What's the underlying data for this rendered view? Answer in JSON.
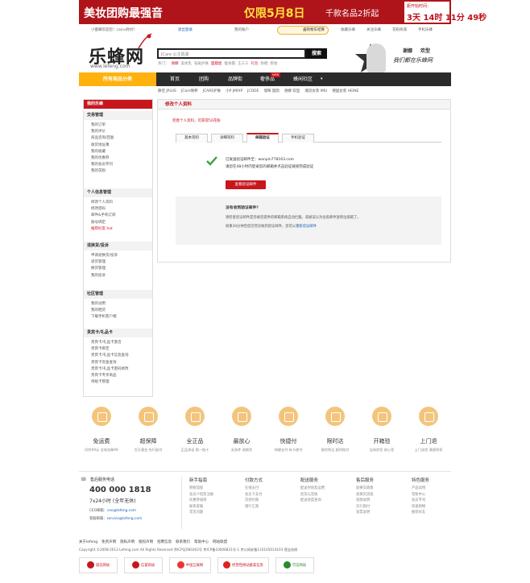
{
  "banner": {
    "headline": "美妆团购最强音",
    "promo": "仅限5月8日",
    "sub": "千款名品2折起",
    "countdown_label": "距开始时间：",
    "countdown": "3天 14时 11分 49秒"
  },
  "topbar": {
    "greeting": "小蜜蜂欢迎您！cairui你好！",
    "logout": "退出登录",
    "account": "我的账户",
    "cart": "去购物车结算",
    "bookmark": "收藏乐蜂",
    "follow": "关注乐蜂",
    "mall": "花粉商城",
    "mobile": "手机乐蜂"
  },
  "logo": {
    "name": "乐蜂网",
    "url": "www.lefeng.com"
  },
  "search": {
    "placeholder": "JCare 公主肌妻",
    "button": "搜索",
    "hot_label": "热门：",
    "hot": [
      "谢娜",
      "美体乳",
      "祛斑护肤",
      "面膜屋",
      "瘦身霜",
      "王三三",
      "礼包",
      "防晒",
      "卸妆"
    ]
  },
  "celebrity": {
    "name": "谢娜",
    "title": "欢型",
    "slogan": "我们都在乐蜂网"
  },
  "nav": {
    "category": "所有商品分类",
    "items": [
      "首页",
      "团购",
      "品牌街",
      "奢侈品",
      "蜂闲社区"
    ],
    "new_badge": "NEW"
  },
  "subnav": [
    "静佳 JPLUS",
    "JCare保养",
    "JCARE护肤",
    "小P JMIXP",
    "JCODE",
    "瑞晖 韶韵",
    "谢娜 欢型",
    "潮流女装 IMU",
    "德国女装 HEINE"
  ],
  "sidebar": {
    "title": "我的乐蜂",
    "sections": [
      {
        "title": "交易管理",
        "items": [
          "我的订单",
          "我的评价",
          "商品咨询/回复",
          "收货地址簿",
          "我的收藏",
          "我的优惠券",
          "我的会员专刊",
          "我的花粉"
        ]
      },
      {
        "title": "个人信息管理",
        "items": [
          "修改个人资料",
          "修改密码",
          "邮件&手机订阅",
          "账号绑定",
          "推荐好友 hot"
        ]
      },
      {
        "title": "退换货/投诉",
        "items": [
          "申请退换货/投诉",
          "退货管理",
          "换货管理",
          "我的投诉"
        ]
      },
      {
        "title": "社区管理",
        "items": [
          "我的试用",
          "我的晒货",
          "下载手机客户端"
        ]
      },
      {
        "title": "贵宾卡/礼品卡",
        "items": [
          "贵宾卡/礼品卡激活",
          "贵宾卡绑定",
          "贵宾卡/礼品卡信息查询",
          "贵宾卡资金查询",
          "贵宾卡/礼品卡密码修改",
          "贵宾卡专享商品",
          "待贴卡管理"
        ]
      }
    ]
  },
  "main": {
    "title": "修改个人资料",
    "progress_text": "完善个人资料，可获得50花粉",
    "tabs": [
      "基本资料",
      "详细资料",
      "邮箱验证",
      "手机验证"
    ],
    "active_tab": 2,
    "sent_msg": "已发送验证邮件至：wanpin778163.com",
    "instruction": "请您在48小时内登录您的邮箱并点击验证链接完成验证",
    "verify_button": "查看验证邮件",
    "faq_title": "没有收到验证邮件？",
    "faq_1": "请检查验证邮件是否被您提供的邮箱系统自动拦截，或被误认为垃圾邮件放到垃圾箱了。",
    "faq_2": "如果30分钟后您仍然没收到验证邮件，您可以",
    "faq_link": "重新验证邮件"
  },
  "features": [
    {
      "title": "免运费",
      "desc": "同付69元 全场包邮69"
    },
    {
      "title": "超保障",
      "desc": "百万基金 先行赔付"
    },
    {
      "title": "全正品",
      "desc": "正品承诺 假一赔十"
    },
    {
      "title": "最放心",
      "desc": "无条件 退换货"
    },
    {
      "title": "快捷付",
      "desc": "快捷支付 有卡便付"
    },
    {
      "title": "限时达",
      "desc": "限时到达 超时赔付"
    },
    {
      "title": "开箱验",
      "desc": "当场验货 放心签"
    },
    {
      "title": "上门退",
      "desc": "上门退货 满意到家"
    }
  ],
  "service": {
    "label": "售后服务电话",
    "phone": "400 000 1818",
    "hours": "7x24小时 (全年无休)",
    "ceo_label": "CEO邮箱：",
    "ceo_email": "ceo@lefeng.com",
    "cs_label": "客服邮箱：",
    "cs_email": "service@lefeng.com"
  },
  "footer_cols": [
    {
      "title": "新手指南",
      "items": [
        "购物流程",
        "会员介绍及注册",
        "优惠券规则",
        "联系客服",
        "常见问题"
      ]
    },
    {
      "title": "付款方式",
      "items": [
        "在线支付",
        "会员卡支付",
        "货到付款",
        "银行汇款"
      ]
    },
    {
      "title": "配送服务",
      "items": [
        "配送时效及运费",
        "验货与签收",
        "配送进度查询"
      ]
    },
    {
      "title": "售后服务",
      "items": [
        "退换货政策",
        "退换货流程",
        "退款说明",
        "先行赔付",
        "发票说明"
      ]
    },
    {
      "title": "特色服务",
      "items": [
        "产品试用",
        "花粉中心",
        "会员专刊",
        "快速购物",
        "推荐好友"
      ]
    }
  ],
  "footer_links": [
    "关于lefeng",
    "免责声明",
    "隐私声明",
    "版权声明",
    "招聘信息",
    "联系我们",
    "帮助中心",
    "网站联盟"
  ],
  "copyright": "Copyright ©2008-2013 Lefeng.com All Rights Reserved 京ICP证080302号 京ICP备10006831号-1 京公网安备110105014103 营业执照",
  "badges": [
    "诚信网站",
    "信誉商站",
    "中国互联网",
    "经营性网站备案信息",
    "可信网站"
  ]
}
